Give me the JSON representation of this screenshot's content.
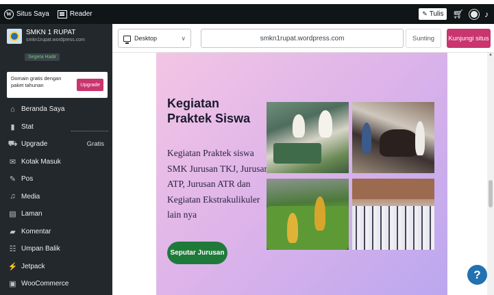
{
  "masterbar": {
    "site_label": "Situs Saya",
    "reader_label": "Reader",
    "write_label": "Tulis"
  },
  "sidebar": {
    "site_name": "SMKN 1 RUPAT",
    "site_url": "smkn1rupat.wordpress.com",
    "coming_soon": "Segera Hadir",
    "upsell_text": "Domain gratis dengan paket tahunan",
    "upsell_button": "Upgrade",
    "items": [
      {
        "label": "Beranda Saya",
        "icon": "home-icon",
        "glyph": "⌂",
        "badge": ""
      },
      {
        "label": "Stat",
        "icon": "stats-icon",
        "glyph": "▮",
        "badge": ""
      },
      {
        "label": "Upgrade",
        "icon": "cart-icon",
        "glyph": "⛟",
        "badge": "Gratis"
      },
      {
        "label": "Kotak Masuk",
        "icon": "mail-icon",
        "glyph": "✉",
        "badge": ""
      },
      {
        "label": "Pos",
        "icon": "pin-icon",
        "glyph": "✎",
        "badge": ""
      },
      {
        "label": "Media",
        "icon": "media-icon",
        "glyph": "♫",
        "badge": ""
      },
      {
        "label": "Laman",
        "icon": "page-icon",
        "glyph": "▤",
        "badge": ""
      },
      {
        "label": "Komentar",
        "icon": "comment-icon",
        "glyph": "▰",
        "badge": ""
      },
      {
        "label": "Umpan Balik",
        "icon": "feedback-icon",
        "glyph": "☷",
        "badge": ""
      },
      {
        "label": "Jetpack",
        "icon": "jetpack-icon",
        "glyph": "⚡",
        "badge": ""
      },
      {
        "label": "WooCommerce",
        "icon": "woo-icon",
        "glyph": "▣",
        "badge": ""
      }
    ]
  },
  "toolbar": {
    "device_label": "Desktop",
    "url": "smkn1rupat.wordpress.com",
    "edit_label": "Sunting",
    "visit_label": "Kunjungi situs"
  },
  "preview": {
    "title": "Kegiatan Praktek Siswa",
    "body": "Kegiatan Praktek siswa SMK Jurusan TKJ, Jurusan ATP, Jurusan ATR dan Kegiatan Ekstrakulikuler lain nya",
    "cta_label": "Seputar Jurusan"
  },
  "help": {
    "label": "?"
  },
  "colors": {
    "masterbar": "#101517",
    "sidebar": "#23282d",
    "accent": "#c9356e",
    "cta": "#1f7a3a",
    "help": "#2271b1"
  }
}
